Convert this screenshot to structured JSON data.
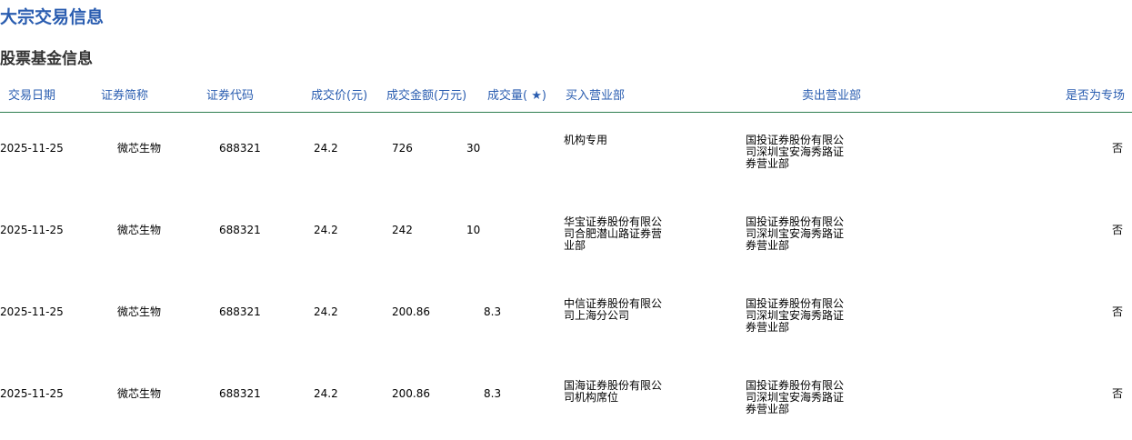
{
  "page": {
    "title": "大宗交易信息",
    "section_title": "股票基金信息"
  },
  "table": {
    "columns": [
      "交易日期",
      "证券简称",
      "证券代码",
      "成交价(元)",
      "成交金额(万元)",
      "成交量( ★)",
      "买入营业部",
      "卖出营业部",
      "是否为专场"
    ],
    "rows": [
      {
        "date": "2025-11-25",
        "name": "微芯生物",
        "code": "688321",
        "price": "24.2",
        "amount": "726",
        "volume": "30",
        "buyer": "机构专用",
        "seller": "国投证券股份有限公司深圳宝安海秀路证券营业部",
        "special": "否"
      },
      {
        "date": "2025-11-25",
        "name": "微芯生物",
        "code": "688321",
        "price": "24.2",
        "amount": "242",
        "volume": "10",
        "buyer": "华宝证券股份有限公司合肥潜山路证券营业部",
        "seller": "国投证券股份有限公司深圳宝安海秀路证券营业部",
        "special": "否"
      },
      {
        "date": "2025-11-25",
        "name": "微芯生物",
        "code": "688321",
        "price": "24.2",
        "amount": "200.86",
        "volume": "8.3",
        "buyer": "中信证券股份有限公司上海分公司",
        "seller": "国投证券股份有限公司深圳宝安海秀路证券营业部",
        "special": "否"
      },
      {
        "date": "2025-11-25",
        "name": "微芯生物",
        "code": "688321",
        "price": "24.2",
        "amount": "200.86",
        "volume": "8.3",
        "buyer": "国海证券股份有限公司机构席位",
        "seller": "国投证券股份有限公司深圳宝安海秀路证券营业部",
        "special": "否"
      }
    ]
  }
}
